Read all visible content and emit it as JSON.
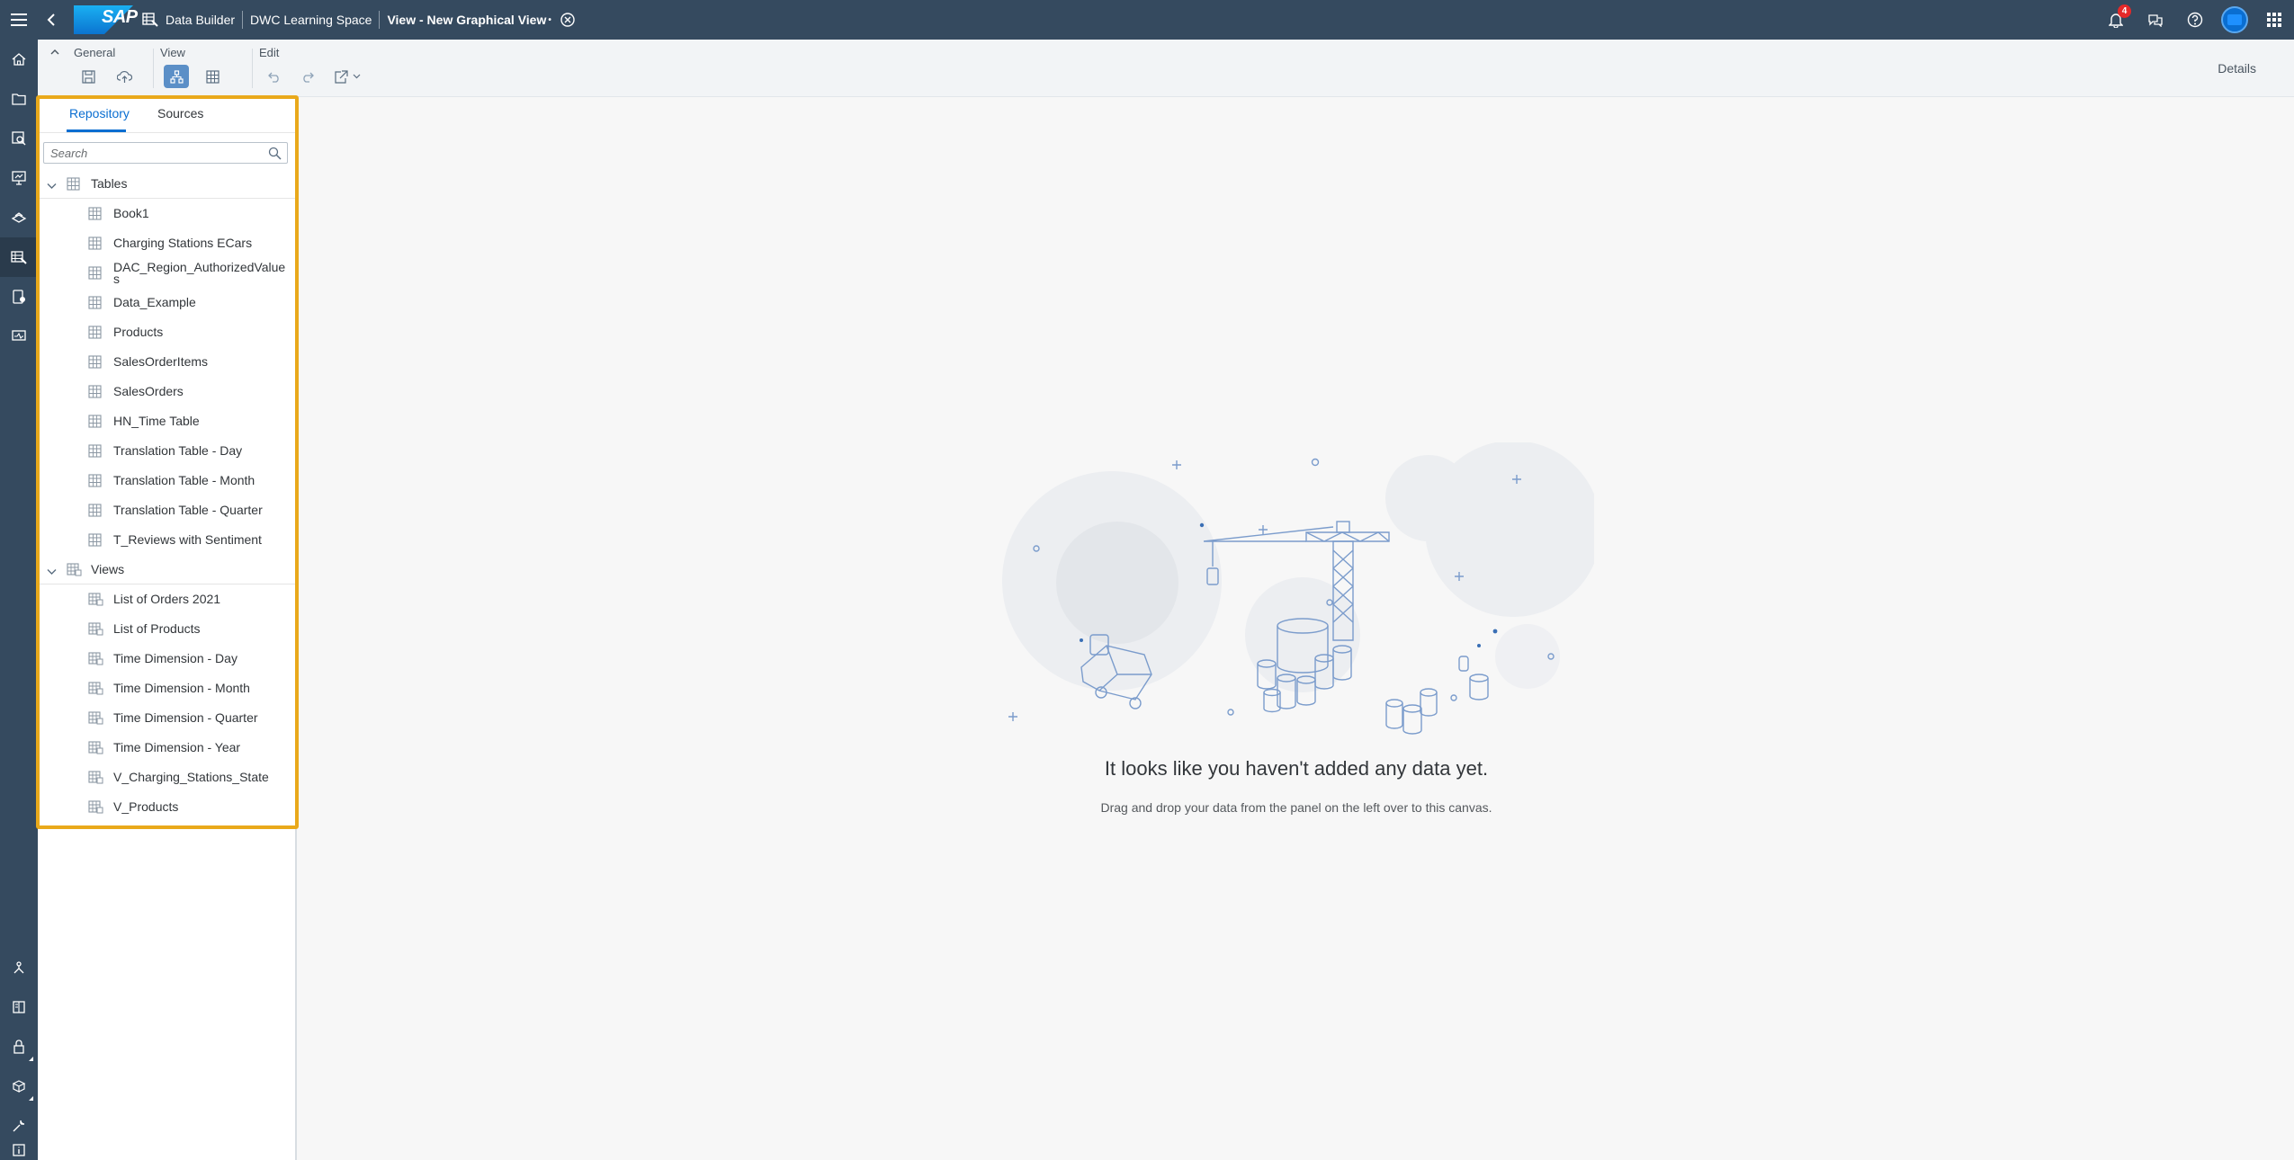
{
  "shell": {
    "logo_text": "SAP",
    "breadcrumbs": [
      "Data Builder",
      "DWC Learning Space"
    ],
    "current": "View - New Graphical View",
    "current_modified_marker": "•",
    "notification_count": "4"
  },
  "left_nav": {
    "top_icons": [
      "home-icon",
      "folder-icon",
      "search-story-icon",
      "presentation-icon",
      "model-icon",
      "data-builder-icon",
      "business-builder-icon",
      "monitor-icon"
    ],
    "bottom_icons": [
      "network-icon",
      "book-icon",
      "lock-icon",
      "package-icon",
      "wrench-icon",
      "info-icon"
    ],
    "active": "data-builder-icon"
  },
  "toolbar": {
    "general_label": "General",
    "view_label": "View",
    "edit_label": "Edit",
    "details_label": "Details"
  },
  "repository": {
    "tabs": [
      "Repository",
      "Sources"
    ],
    "active_tab": "Repository",
    "search_placeholder": "Search",
    "groups": [
      {
        "label": "Tables",
        "items": [
          "Book1",
          "Charging Stations ECars",
          "DAC_Region_AuthorizedValue s",
          "Data_Example",
          "Products",
          "SalesOrderItems",
          "SalesOrders",
          "HN_Time Table",
          "Translation Table - Day",
          "Translation Table - Month",
          "Translation Table - Quarter",
          "T_Reviews with Sentiment"
        ]
      },
      {
        "label": "Views",
        "items": [
          "List of Orders 2021",
          "List of Products",
          "Time Dimension - Day",
          "Time Dimension - Month",
          "Time Dimension - Quarter",
          "Time Dimension - Year",
          "V_Charging_Stations_State",
          "V_Products"
        ]
      }
    ]
  },
  "canvas": {
    "empty_title": "It looks like you haven't added any data yet.",
    "empty_description": "Drag and drop your data from the panel on the left over to this canvas."
  },
  "colors": {
    "shell": "#354a5f",
    "accent": "#0a6ed1",
    "highlight": "#e9a91b",
    "badge": "#e52929"
  }
}
